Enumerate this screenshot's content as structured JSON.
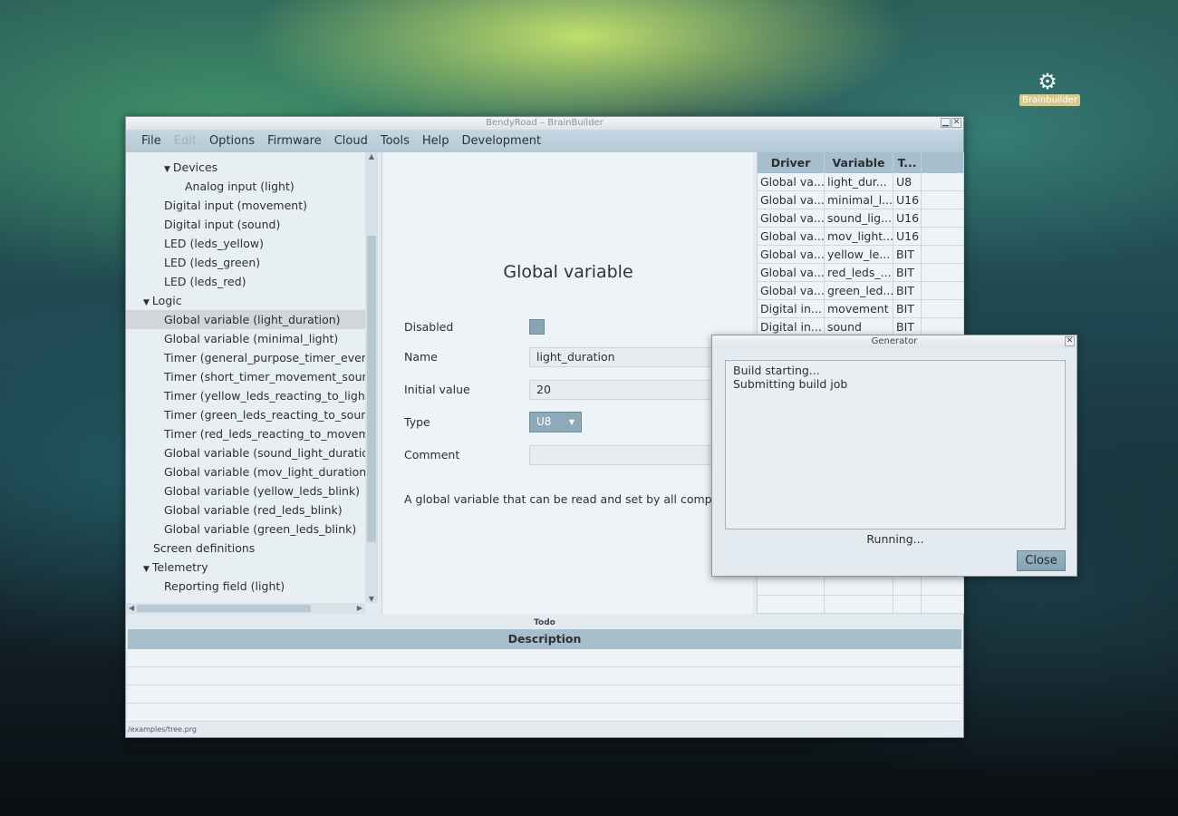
{
  "desktop": {
    "icon_label": "Brainbuilder",
    "icon": "gear-icon"
  },
  "window": {
    "title": "BendyRoad – BrainBuilder",
    "menu": [
      {
        "label": "File",
        "disabled": false
      },
      {
        "label": "Edit",
        "disabled": true
      },
      {
        "label": "Options",
        "disabled": false
      },
      {
        "label": "Firmware",
        "disabled": false
      },
      {
        "label": "Cloud",
        "disabled": false
      },
      {
        "label": "Tools",
        "disabled": false
      },
      {
        "label": "Help",
        "disabled": false
      },
      {
        "label": "Development",
        "disabled": false
      }
    ]
  },
  "tree": {
    "devices_label": "Devices",
    "devices": [
      "Analog input (light)",
      "Digital input (movement)",
      "Digital input (sound)",
      "LED (leds_yellow)",
      "LED (leds_green)",
      "LED (leds_red)"
    ],
    "logic_label": "Logic",
    "logic": [
      "Global variable (light_duration)",
      "Global variable (minimal_light)",
      "Timer (general_purpose_timer_every_",
      "Timer (short_timer_movement_sound_",
      "Timer (yellow_leds_reacting_to_light)",
      "Timer (green_leds_reacting_to_sound)",
      "Timer (red_leds_reacting_to_moveme",
      "Global variable (sound_light_duration)",
      "Global variable (mov_light_duration)",
      "Global variable (yellow_leds_blink)",
      "Global variable (red_leds_blink)",
      "Global variable (green_leds_blink)"
    ],
    "screen_definitions": "Screen definitions",
    "telemetry_label": "Telemetry",
    "telemetry": [
      "Reporting field (light)"
    ]
  },
  "detail": {
    "title": "Global variable",
    "disabled_label": "Disabled",
    "name_label": "Name",
    "name_value": "light_duration",
    "initial_label": "Initial value",
    "initial_value": "20",
    "type_label": "Type",
    "type_value": "U8",
    "comment_label": "Comment",
    "comment_value": "",
    "description": "A global variable that can be read and set by all componen"
  },
  "table": {
    "headers": [
      "Driver",
      "Variable",
      "T..."
    ],
    "rows": [
      [
        "Global va...",
        "light_dur...",
        "U8"
      ],
      [
        "Global va...",
        "minimal_l...",
        "U16"
      ],
      [
        "Global va...",
        "sound_lig...",
        "U16"
      ],
      [
        "Global va...",
        "mov_light...",
        "U16"
      ],
      [
        "Global va...",
        "yellow_le...",
        "BIT"
      ],
      [
        "Global va...",
        "red_leds_...",
        "BIT"
      ],
      [
        "Global va...",
        "green_led...",
        "BIT"
      ],
      [
        "Digital in...",
        "movement",
        "BIT"
      ],
      [
        "Digital in...",
        "sound",
        "BIT"
      ]
    ]
  },
  "todo": {
    "title": "Todo",
    "header": "Description"
  },
  "status_path": "/examples/tree.prg",
  "dialog": {
    "title": "Generator",
    "log_lines": [
      "Build starting...",
      "Submitting build job"
    ],
    "status": "Running...",
    "close_label": "Close"
  }
}
